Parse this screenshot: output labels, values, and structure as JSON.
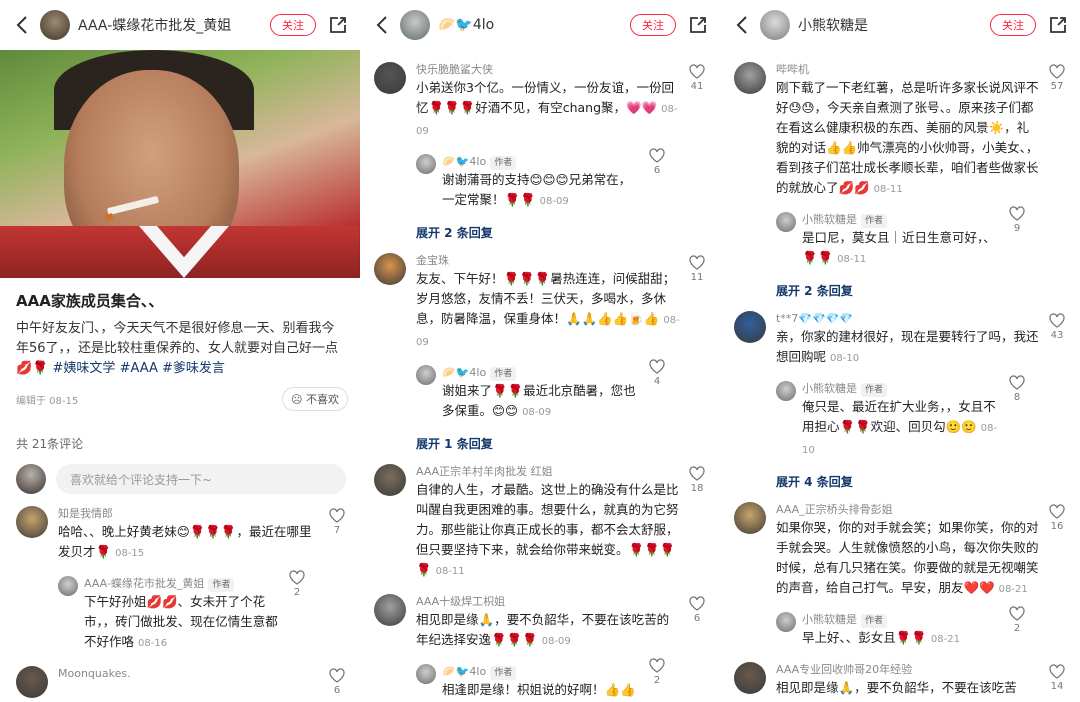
{
  "panels": [
    {
      "header": {
        "name": "AAA-蝶缘花市批发_黄姐",
        "follow": "关注"
      },
      "post": {
        "title": "AAA家族成员集合、、",
        "body": "中午好友友门、，今天天气不是很好修息一天、别看我今年56了，，还是比较柱重保养的、女人就要对自己好一点",
        "tags": [
          "#姨味文学",
          "#AAA",
          "#爹味发言"
        ],
        "date": "编辑于 08-15",
        "dislike": "不喜欢"
      },
      "total": "共 21条评论",
      "input_placeholder": "喜欢就给个评论支持一下~",
      "comments": [
        {
          "name": "知是我情郎",
          "text": "哈哈、、晚上好黄老妹",
          "emoji": "😊🌹🌹🌹",
          "text2": "，最近在哪里发贝才",
          "emoji2": "🌹",
          "date": "08-15",
          "likes": "7",
          "replies": [
            {
              "name": "AAA-蝶缘花市批发_黄姐",
              "author": "作者",
              "text": "下午好孙姐",
              "emoji": "💋💋",
              "text2": "、女未开了个花市，，砖门做批发、现在亿情生意都不好作咯",
              "date": "08-16",
              "likes": "2"
            }
          ]
        },
        {
          "name": "Moonquakes.",
          "text": "",
          "date": "",
          "likes": "6",
          "replies": []
        }
      ]
    },
    {
      "header": {
        "name": "🥟🐦4lo",
        "follow": "关注"
      },
      "comments": [
        {
          "name": "快乐脆脆鲨大侠",
          "text": "小弟送你3个亿。一份情义，一份友谊，一份回忆🌹🌹🌹好酒不见，有空chang聚，",
          "emoji": "💗💗",
          "date": "08-09",
          "likes": "41",
          "replies": [
            {
              "name": "🥟🐦4lo",
              "author": "作者",
              "text": "谢谢蒲哥的支持😊😊😊兄弟常在，一定常聚！🌹🌹",
              "date": "08-09",
              "likes": "6"
            }
          ],
          "more": "展开 2 条回复"
        },
        {
          "name": "金宝珠",
          "text": "友友、下午好！🌹🌹🌹暑热连连，问候甜甜；岁月悠悠，友情不丢！三伏天，多喝水，多休息，防暑降温，保重身体！🙏🙏👍👍🍺👍",
          "date": "08-09",
          "likes": "11",
          "replies": [
            {
              "name": "🥟🐦4lo",
              "author": "作者",
              "text": "谢姐来了🌹🌹最近北京酷暑，您也多保重。😊😊",
              "date": "08-09",
              "likes": "4"
            }
          ],
          "more": "展开 1 条回复"
        },
        {
          "name": "AAA正宗羊村羊肉批发 红姐",
          "text": "自律的人生，才最酷。这世上的确没有什么是比叫醒自我更困难的事。想要什么，就真的为它努力。那些能让你真正成长的事，都不会太舒服，但只要坚持下来，就会给你带来蜕变。🌹🌹🌹🌹",
          "date": "08-11",
          "likes": "18",
          "replies": []
        },
        {
          "name": "AAA十级焊工枳姐",
          "text": "相见即是缘🙏，要不负韶华，不要在该吃苦的年纪选择安逸🌹🌹🌹",
          "date": "08-09",
          "likes": "6",
          "replies": [
            {
              "name": "🥟🐦4lo",
              "author": "作者",
              "text": "相逢即是缘！枳姐说的好啊！👍👍👍",
              "date": "",
              "likes": "2"
            }
          ]
        }
      ]
    },
    {
      "header": {
        "name": "小熊软糖是",
        "follow": "关注"
      },
      "comments": [
        {
          "name": "哔哔机",
          "text": "刚下载了一下老红薯，总是听许多家长说风评不好😓😓，今天亲自煮测了张号、。原来孩子们都在看这么健康积极的东西、美丽的风景☀️，礼貌的对话👍👍帅气漂亮的小伙帅哥，小美女、，看到孩子们茁壮成长孝顺长辈，咱们者些做家长的就放心了💋💋",
          "date": "08-11",
          "likes": "57",
          "replies": [
            {
              "name": "小熊软糖是",
              "author": "作者",
              "text": "是口尼，莫女且｜近日生意可好，、🌹🌹",
              "date": "08-11",
              "likes": "9"
            }
          ],
          "more": "展开 2 条回复"
        },
        {
          "name": "t**7💎💎💎💎",
          "text": "亲，你家的建材很好，现在是要转行了吗，我还想回购呢",
          "date": "08-10",
          "likes": "43",
          "replies": [
            {
              "name": "小熊软糖是",
              "author": "作者",
              "text": "俺只是、最近在扩大业务，，女且不用担心🌹🌹欢迎、回贝勾🙂🙂",
              "date": "08-10",
              "likes": "8"
            }
          ],
          "more": "展开 4 条回复"
        },
        {
          "name": "AAA_正宗桥头排骨彭姐",
          "text": "如果你哭，你的对手就会笑；如果你笑，你的对手就会哭。人生就像愤怒的小鸟，每次你失败的时候，总有几只猪在笑。你要做的就是无视嘲笑的声音，给自己打气。早安，朋友❤️❤️",
          "date": "08-21",
          "likes": "16",
          "replies": [
            {
              "name": "小熊软糖是",
              "author": "作者",
              "text": "早上好、、彭女且🌹🌹",
              "date": "08-21",
              "likes": "2"
            }
          ]
        },
        {
          "name": "AAA专业回收帅哥20年经验",
          "text": "相见即是缘🙏，要不负韶华，不要在该吃苦",
          "date": "",
          "likes": "14",
          "replies": []
        }
      ]
    }
  ],
  "colors": {
    "accent": "#ff2442",
    "link": "#13386c"
  }
}
